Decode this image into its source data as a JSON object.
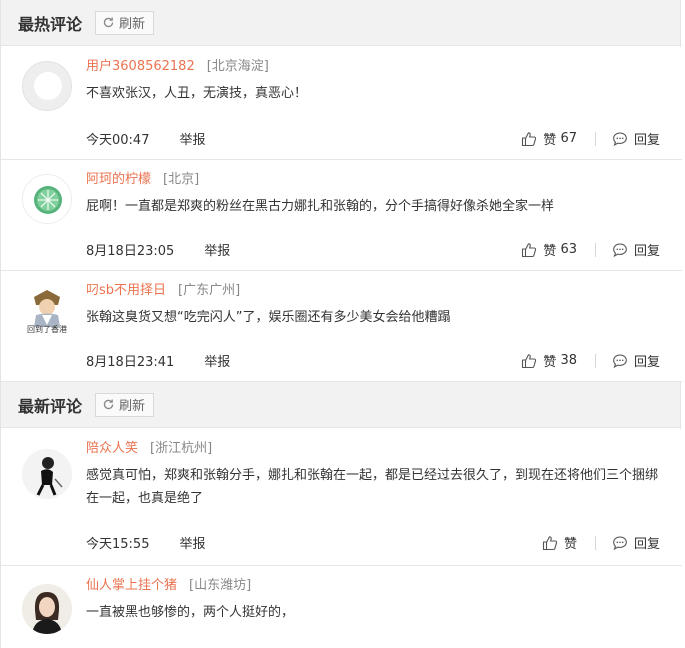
{
  "hot": {
    "title": "最热评论",
    "refresh_label": "刷新",
    "comments": [
      {
        "user": "用户3608562182",
        "location": "[北京海淀]",
        "text": "不喜欢张汉，人丑，无演技，真恶心！",
        "time": "今天00:47",
        "report": "举报",
        "like_label": "赞",
        "likes": "67",
        "reply": "回复"
      },
      {
        "user": "阿珂的柠檬",
        "location": "[北京]",
        "text": "屁啊！一直都是郑爽的粉丝在黑古力娜扎和张翰的，分个手搞得好像杀她全家一样",
        "time": "8月18日23:05",
        "report": "举报",
        "like_label": "赞",
        "likes": "63",
        "reply": "回复"
      },
      {
        "user": "叼sb不用择日",
        "location": "[广东广州]",
        "text": "张翰这臭货又想“吃完闪人”了，娱乐圈还有多少美女会给他糟蹋",
        "time": "8月18日23:41",
        "report": "举报",
        "like_label": "赞",
        "likes": "38",
        "reply": "回复",
        "avatar_caption": "回到了香港"
      }
    ]
  },
  "latest": {
    "title": "最新评论",
    "refresh_label": "刷新",
    "comments": [
      {
        "user": "陪众人笑",
        "location": "[浙江杭州]",
        "text": "感觉真可怕，郑爽和张翰分手，娜扎和张翰在一起，都是已经过去很久了，到现在还将他们三个捆绑在一起，也真是绝了",
        "time": "今天15:55",
        "report": "举报",
        "like_label": "赞",
        "likes": "",
        "reply": "回复"
      },
      {
        "user": "仙人掌上挂个猪",
        "location": "[山东潍坊]",
        "text": "一直被黑也够惨的，两个人挺好的，"
      }
    ]
  },
  "icons": {
    "refresh": "refresh-icon",
    "like": "thumbs-up-icon",
    "reply": "speech-bubble-icon"
  },
  "colors": {
    "username": "#eb7350",
    "location": "#888888",
    "header_bg": "#f2f2f2"
  }
}
